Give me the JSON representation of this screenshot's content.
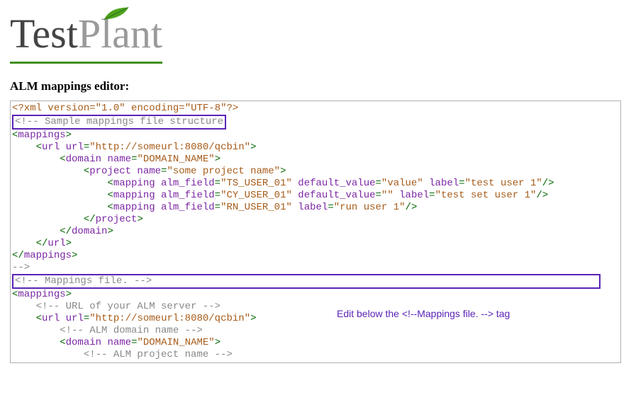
{
  "logo": {
    "part1": "Test",
    "part2": "Plant"
  },
  "heading": "ALM mappings editor:",
  "annotation": "Edit below the <!--Mappings file. --> tag",
  "code": {
    "l01a": "<?xml",
    "l01b": " version",
    "l01c": "=",
    "l01d": "\"1.0\"",
    "l01e": " encoding",
    "l01f": "=",
    "l01g": "\"UTF-8\"",
    "l01h": "?>",
    "l02": "<!-- Sample mappings file structure",
    "l03a": "<",
    "l03b": "mappings",
    "l03c": ">",
    "l04a": "    <",
    "l04b": "url",
    "l04c": " url",
    "l04d": "=",
    "l04e": "\"http://someurl:8080/qcbin\"",
    "l04f": ">",
    "l05a": "        <",
    "l05b": "domain",
    "l05c": " name",
    "l05d": "=",
    "l05e": "\"DOMAIN_NAME\"",
    "l05f": ">",
    "l06a": "            <",
    "l06b": "project",
    "l06c": " name",
    "l06d": "=",
    "l06e": "\"some project name\"",
    "l06f": ">",
    "l07a": "                <",
    "l07b": "mapping",
    "l07c": " alm_field",
    "l07d": "=",
    "l07e": "\"TS_USER_01\"",
    "l07f": " default_value",
    "l07g": "=",
    "l07h": "\"value\"",
    "l07i": " label",
    "l07j": "=",
    "l07k": "\"test user 1\"",
    "l07l": "/>",
    "l08a": "                <",
    "l08b": "mapping",
    "l08c": " alm_field",
    "l08d": "=",
    "l08e": "\"CY_USER_01\"",
    "l08f": " default_value",
    "l08g": "=",
    "l08h": "\"\"",
    "l08i": " label",
    "l08j": "=",
    "l08k": "\"test set user 1\"",
    "l08l": "/>",
    "l09a": "                <",
    "l09b": "mapping",
    "l09c": " alm_field",
    "l09d": "=",
    "l09e": "\"RN_USER_01\"",
    "l09f": " label",
    "l09g": "=",
    "l09h": "\"run user 1\"",
    "l09i": "/>",
    "l10a": "            </",
    "l10b": "project",
    "l10c": ">",
    "l11a": "        </",
    "l11b": "domain",
    "l11c": ">",
    "l12a": "    </",
    "l12b": "url",
    "l12c": ">",
    "l13a": "</",
    "l13b": "mappings",
    "l13c": ">",
    "l14": "-->",
    "l15": "<!-- Mappings file. -->",
    "l16a": "<",
    "l16b": "mappings",
    "l16c": ">",
    "l17": "    <!-- URL of your ALM server -->",
    "l18a": "    <",
    "l18b": "url",
    "l18c": " url",
    "l18d": "=",
    "l18e": "\"http://someurl:8080/qcbin\"",
    "l18f": ">",
    "l19": "        <!-- ALM domain name -->",
    "l20a": "        <",
    "l20b": "domain",
    "l20c": " name",
    "l20d": "=",
    "l20e": "\"DOMAIN_NAME\"",
    "l20f": ">",
    "l21": "            <!-- ALM project name -->"
  }
}
